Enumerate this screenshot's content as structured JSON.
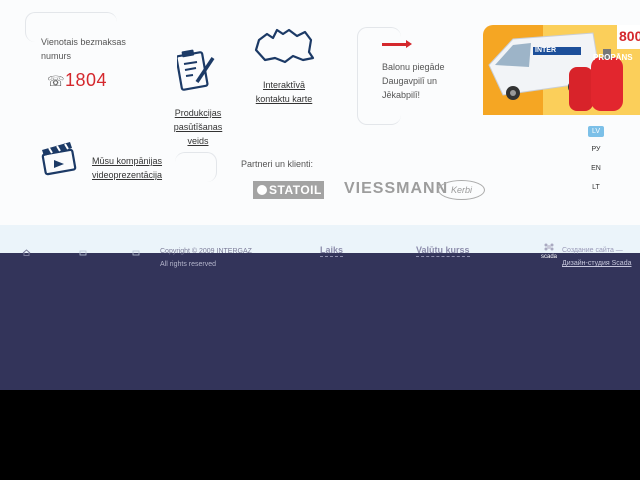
{
  "phone": {
    "label": "Vienotais bezmaksas numurs",
    "number": "1804"
  },
  "features": {
    "products_link": "Produkcijas pasūtīšanas veids",
    "map_link": "Interaktīvā kontaktu karte",
    "delivery_text": "Balonu piegāde Daugavpilī un Jēkabpilī!",
    "video_link": "Mūsu kompānijas videoprezentācija"
  },
  "partners": {
    "heading": "Partneri un klienti:",
    "logos": [
      "STATOIL",
      "VIESSMANN",
      "Kerbi"
    ]
  },
  "banner": {
    "brand": "INTER",
    "tank_label": "PROPĀNS",
    "number_fragment": "800"
  },
  "languages": {
    "items": [
      "LV",
      "РУ",
      "EN",
      "LT"
    ],
    "active": "LV"
  },
  "footer": {
    "copyright": "Copyright © 2009 INTERGAZ",
    "rights": "All rights reserved",
    "tab_weather": "Laiks",
    "tab_currency": "Valūtu kurss",
    "scada_logo": "scada",
    "scada_line1": "Создание сайта —",
    "scada_line2": "Дизайн-студия Scada"
  },
  "colors": {
    "accent_red": "#d4282d",
    "navy": "#33345a",
    "light_band": "#ebf4fa",
    "lang_active": "#7cc0e8"
  }
}
